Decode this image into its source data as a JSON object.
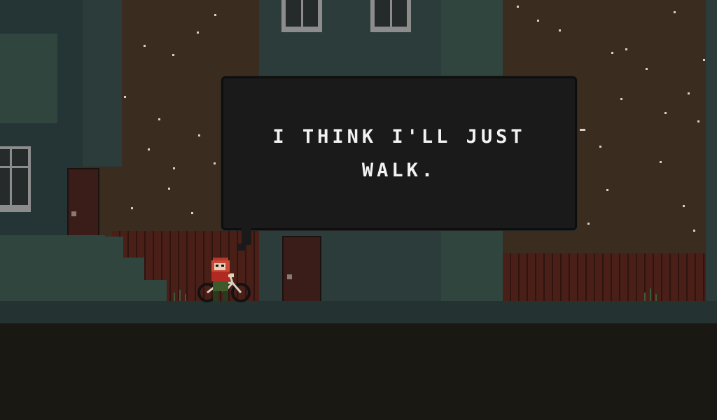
{
  "dialogue": {
    "line1": "I THINK I'LL JUST",
    "line2": "WALK."
  },
  "palette": {
    "sky": "#3a2c1e",
    "building": "#2b3c3b",
    "fence": "#4a1f18",
    "door": "#3a1d18",
    "bubble": "#1a1a1a",
    "text": "#f2f2f2"
  },
  "icons": [
    "player-character-icon",
    "bicycle-icon",
    "star-icon"
  ]
}
